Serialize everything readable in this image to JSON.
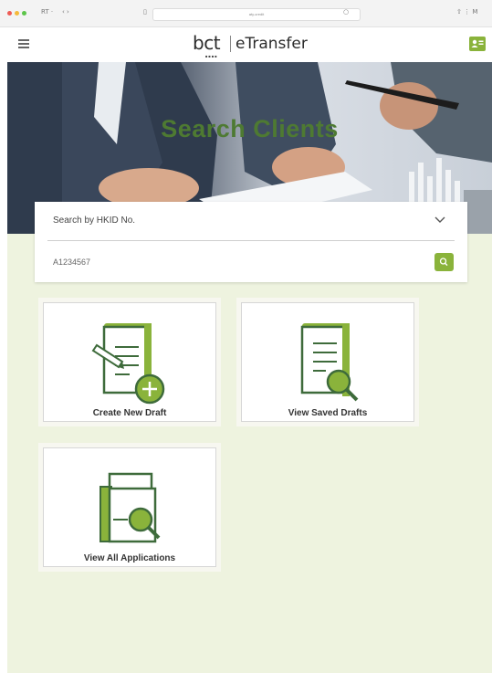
{
  "browser": {
    "toolbar_text": "RT ·",
    "nav_arrows": "‹  ›",
    "url": "aty-credit",
    "right_text": "⇧  ⋮  M"
  },
  "header": {
    "logo_main": "bct",
    "logo_dots": "■■■■",
    "logo_product": "eTransfer",
    "menu_icon": "hamburger-icon",
    "user_icon": "user-card-icon"
  },
  "hero": {
    "title": "Search Clients"
  },
  "search": {
    "select_label": "Search by HKID No.",
    "input_value": "A1234567",
    "button_icon": "search-icon"
  },
  "tiles": [
    {
      "label": "Create New Draft",
      "icon": "create-draft-icon"
    },
    {
      "label": "View Saved Drafts",
      "icon": "view-drafts-icon"
    },
    {
      "label": "View All Applications",
      "icon": "applications-icon"
    }
  ],
  "colors": {
    "accent": "#8ab33b",
    "hero_title": "#4e7a32",
    "icon_green": "#4c8a3a",
    "content_bg": "#eef3df"
  }
}
